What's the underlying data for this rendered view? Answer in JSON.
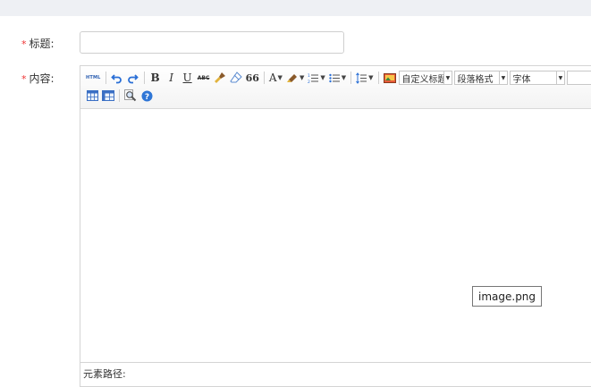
{
  "form": {
    "title_label": "标题:",
    "content_label": "内容:",
    "required_mark": "*",
    "title_value": "",
    "title_placeholder": ""
  },
  "toolbar": {
    "html_label": "HTML",
    "bold_label": "B",
    "italic_label": "I",
    "underline_label": "U",
    "strike_label": "ABC",
    "quote_label": "66",
    "fontcolor_label": "A",
    "custom_heading_select": "自定义标题",
    "paragraph_select": "段落格式",
    "font_select": "字体"
  },
  "statusbar": {
    "element_path_label": "元素路径:"
  },
  "tooltip": {
    "text": "image.png"
  }
}
